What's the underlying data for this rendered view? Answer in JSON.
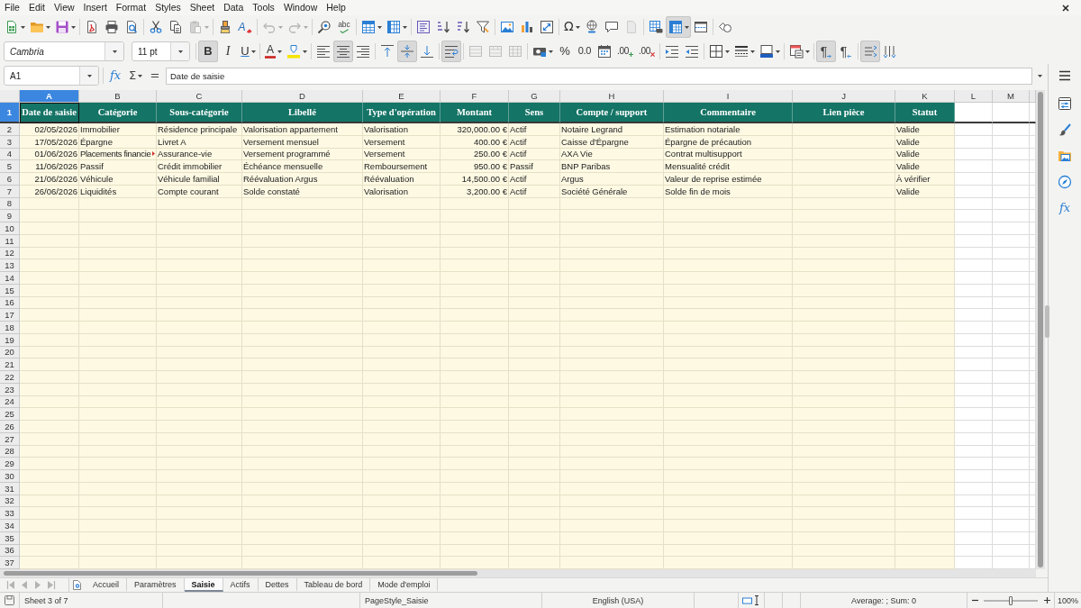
{
  "menu_bar": {
    "items": [
      "File",
      "Edit",
      "View",
      "Insert",
      "Format",
      "Styles",
      "Sheet",
      "Data",
      "Tools",
      "Window",
      "Help"
    ]
  },
  "standard_toolbar": {
    "groups": [
      [
        {
          "kind": "new",
          "dropdown": true,
          "active": false,
          "disabled": false
        },
        {
          "kind": "open",
          "dropdown": true,
          "active": false,
          "disabled": false
        },
        {
          "kind": "save",
          "dropdown": true,
          "active": false,
          "disabled": false
        }
      ],
      [
        {
          "kind": "pdf",
          "dropdown": false,
          "active": false,
          "disabled": false
        },
        {
          "kind": "print",
          "dropdown": false,
          "active": false,
          "disabled": false
        },
        {
          "kind": "preview",
          "dropdown": false,
          "active": false,
          "disabled": false
        }
      ],
      [
        {
          "kind": "cut",
          "dropdown": false,
          "active": false,
          "disabled": false
        },
        {
          "kind": "copy",
          "dropdown": false,
          "active": false,
          "disabled": false
        },
        {
          "kind": "paste",
          "dropdown": true,
          "active": false,
          "disabled": true
        }
      ],
      [
        {
          "kind": "clone",
          "dropdown": false,
          "active": false,
          "disabled": false
        },
        {
          "kind": "clear",
          "glyph": "A",
          "dropdown": false,
          "active": false,
          "disabled": false
        }
      ],
      [
        {
          "kind": "undo",
          "dropdown": true,
          "active": false,
          "disabled": true
        },
        {
          "kind": "redo",
          "dropdown": true,
          "active": false,
          "disabled": true
        }
      ],
      [
        {
          "kind": "find",
          "dropdown": false,
          "active": false,
          "disabled": false
        },
        {
          "kind": "spell",
          "glyph": "abc",
          "dropdown": false,
          "active": false,
          "disabled": false
        }
      ],
      [
        {
          "kind": "rows",
          "dropdown": true,
          "active": false,
          "disabled": false
        },
        {
          "kind": "columns",
          "dropdown": true,
          "active": false,
          "disabled": false
        }
      ],
      [
        {
          "kind": "sort",
          "dropdown": false,
          "active": false,
          "disabled": false
        },
        {
          "kind": "ascending",
          "dropdown": false,
          "active": false,
          "disabled": false
        },
        {
          "kind": "descending",
          "dropdown": false,
          "active": false,
          "disabled": false
        },
        {
          "kind": "filter",
          "dropdown": false,
          "active": false,
          "disabled": false
        }
      ],
      [
        {
          "kind": "image",
          "dropdown": false,
          "active": false,
          "disabled": false
        },
        {
          "kind": "chart",
          "dropdown": false,
          "active": false,
          "disabled": false
        },
        {
          "kind": "pivot",
          "dropdown": false,
          "active": false,
          "disabled": false
        }
      ],
      [
        {
          "kind": "special",
          "glyph": "Ω",
          "dropdown": true,
          "active": false,
          "disabled": false
        },
        {
          "kind": "link",
          "dropdown": false,
          "active": false,
          "disabled": false
        },
        {
          "kind": "comment",
          "dropdown": false,
          "active": false,
          "disabled": false
        },
        {
          "kind": "headers",
          "dropdown": false,
          "active": false,
          "disabled": true
        }
      ],
      [
        {
          "kind": "printarea",
          "dropdown": false,
          "active": false,
          "disabled": false
        },
        {
          "kind": "freeze",
          "dropdown": true,
          "active": true,
          "disabled": false
        },
        {
          "kind": "split",
          "dropdown": false,
          "active": false,
          "disabled": false
        }
      ],
      [
        {
          "kind": "shapes",
          "dropdown": false,
          "active": false,
          "disabled": false
        }
      ]
    ]
  },
  "formatting_toolbar": {
    "font_name": "Cambria",
    "font_size": "11 pt",
    "groups": [
      [
        {
          "kind": "bold",
          "glyph": "B",
          "dropdown": false,
          "active": true,
          "disabled": false
        },
        {
          "kind": "italic",
          "glyph": "I",
          "dropdown": false,
          "active": false,
          "disabled": false
        },
        {
          "kind": "underline",
          "glyph": "U",
          "dropdown": true,
          "active": false,
          "disabled": false
        }
      ],
      [
        {
          "kind": "fontcolor",
          "glyph": "A",
          "dropdown": true,
          "active": false,
          "disabled": false
        },
        {
          "kind": "highlight",
          "dropdown": true,
          "active": false,
          "disabled": false
        }
      ],
      [
        {
          "kind": "left",
          "dropdown": false,
          "active": false,
          "disabled": false
        },
        {
          "kind": "center",
          "dropdown": false,
          "active": true,
          "disabled": false
        },
        {
          "kind": "right",
          "dropdown": false,
          "active": false,
          "disabled": false
        }
      ],
      [
        {
          "kind": "top",
          "dropdown": false,
          "active": false,
          "disabled": false
        },
        {
          "kind": "middle",
          "dropdown": false,
          "active": true,
          "disabled": false
        },
        {
          "kind": "bottom",
          "dropdown": false,
          "active": false,
          "disabled": false
        }
      ],
      [
        {
          "kind": "wrap",
          "dropdown": false,
          "active": true,
          "disabled": false
        }
      ],
      [
        {
          "kind": "mergecenter",
          "dropdown": false,
          "active": false,
          "disabled": true
        },
        {
          "kind": "merge",
          "dropdown": false,
          "active": false,
          "disabled": true
        },
        {
          "kind": "unmerge",
          "dropdown": false,
          "active": false,
          "disabled": true
        }
      ],
      [
        {
          "kind": "currency",
          "dropdown": true,
          "active": false,
          "disabled": false
        },
        {
          "kind": "percent",
          "glyph": "%",
          "dropdown": false,
          "active": false,
          "disabled": false
        },
        {
          "kind": "number",
          "glyph": "0.0",
          "dropdown": false,
          "active": false,
          "disabled": false
        },
        {
          "kind": "date",
          "dropdown": false,
          "active": false,
          "disabled": false
        },
        {
          "kind": "adddecimal",
          "glyph": ".00",
          "dropdown": false,
          "active": false,
          "disabled": false
        },
        {
          "kind": "deletedecimal",
          "glyph": ".00",
          "dropdown": false,
          "active": false,
          "disabled": false
        }
      ],
      [
        {
          "kind": "indent",
          "dropdown": false,
          "active": false,
          "disabled": false
        },
        {
          "kind": "outdent",
          "dropdown": false,
          "active": false,
          "disabled": false
        }
      ],
      [
        {
          "kind": "borders",
          "dropdown": true,
          "active": false,
          "disabled": false
        },
        {
          "kind": "borderstyle",
          "dropdown": true,
          "active": false,
          "disabled": false
        },
        {
          "kind": "bordercolor",
          "dropdown": true,
          "active": false,
          "disabled": false
        }
      ],
      [
        {
          "kind": "conditional",
          "dropdown": true,
          "active": false,
          "disabled": false
        }
      ],
      [
        {
          "kind": "ltr",
          "glyph": "¶",
          "dropdown": false,
          "active": true,
          "disabled": false
        },
        {
          "kind": "rtl",
          "glyph": "¶",
          "dropdown": false,
          "active": false,
          "disabled": false
        }
      ],
      [
        {
          "kind": "horizontal",
          "dropdown": false,
          "active": true,
          "disabled": false
        },
        {
          "kind": "vertical",
          "dropdown": false,
          "active": false,
          "disabled": false
        }
      ]
    ]
  },
  "formula_bar": {
    "name_box": "A1",
    "function_wizard": "fx",
    "sum": "Σ",
    "formula": "=",
    "content": "Date de saisie"
  },
  "sheet": {
    "columns": [
      {
        "letter": "A",
        "kind": "date",
        "selected": true
      },
      {
        "letter": "B",
        "kind": "text",
        "selected": false
      },
      {
        "letter": "C",
        "kind": "text",
        "selected": false
      },
      {
        "letter": "D",
        "kind": "text",
        "selected": false
      },
      {
        "letter": "E",
        "kind": "text",
        "selected": false
      },
      {
        "letter": "F",
        "kind": "amount",
        "selected": false
      },
      {
        "letter": "G",
        "kind": "text",
        "selected": false
      },
      {
        "letter": "H",
        "kind": "text",
        "selected": false
      },
      {
        "letter": "I",
        "kind": "text",
        "selected": false
      },
      {
        "letter": "J",
        "kind": "text",
        "selected": false
      },
      {
        "letter": "K",
        "kind": "text",
        "selected": false
      },
      {
        "letter": "L",
        "kind": "blank",
        "selected": false
      },
      {
        "letter": "M",
        "kind": "blank",
        "selected": false
      }
    ],
    "rows": [
      {
        "number": "1",
        "kind": "header",
        "selected": true,
        "cells": [
          "Date de saisie",
          "Catégorie",
          "Sous-catégorie",
          "Libellé",
          "Type d'opération",
          "Montant",
          "Sens",
          "Compte / support",
          "Commentaire",
          "Lien pièce",
          "Statut"
        ]
      },
      {
        "number": "2",
        "kind": "data",
        "selected": false,
        "cells": [
          "02/05/2026",
          "Immobilier",
          "Résidence principale",
          "Valorisation appartement",
          "Valorisation",
          "320,000.00 €",
          "Actif",
          "Notaire Legrand",
          "Estimation notariale",
          null,
          "Valide"
        ]
      },
      {
        "number": "3",
        "kind": "data",
        "selected": false,
        "cells": [
          "17/05/2026",
          "Épargne",
          "Livret A",
          "Versement mensuel",
          "Versement",
          "400.00 €",
          "Actif",
          "Caisse d'Épargne",
          "Épargne de précaution",
          null,
          "Valide"
        ]
      },
      {
        "number": "4",
        "kind": "data",
        "selected": false,
        "cells": [
          "01/06/2026",
          {
            "text": "Placements financie",
            "clipped": true
          },
          "Assurance-vie",
          "Versement programmé",
          "Versement",
          "250.00 €",
          "Actif",
          "AXA Vie",
          "Contrat multisupport",
          null,
          "Valide"
        ]
      },
      {
        "number": "5",
        "kind": "data",
        "selected": false,
        "cells": [
          "11/06/2026",
          "Passif",
          "Crédit immobilier",
          "Échéance mensuelle",
          "Remboursement",
          "950.00 €",
          "Passif",
          "BNP Paribas",
          "Mensualité crédit",
          null,
          "Valide"
        ]
      },
      {
        "number": "6",
        "kind": "data",
        "selected": false,
        "cells": [
          "21/06/2026",
          "Véhicule",
          "Véhicule familial",
          "Réévaluation Argus",
          "Réévaluation",
          "14,500.00 €",
          "Actif",
          "Argus",
          "Valeur de reprise estimée",
          null,
          "À vérifier"
        ]
      },
      {
        "number": "7",
        "kind": "data",
        "selected": false,
        "cells": [
          "26/06/2026",
          "Liquidités",
          "Compte courant",
          "Solde constaté",
          "Valorisation",
          "3,200.00 €",
          "Actif",
          "Société Générale",
          "Solde fin de mois",
          null,
          "Valide"
        ]
      },
      {
        "number": "8",
        "kind": "data",
        "selected": false
      },
      {
        "number": "9",
        "kind": "data",
        "selected": false
      },
      {
        "number": "10",
        "kind": "data",
        "selected": false
      },
      {
        "number": "11",
        "kind": "data",
        "selected": false
      },
      {
        "number": "12",
        "kind": "data",
        "selected": false
      },
      {
        "number": "13",
        "kind": "data",
        "selected": false
      },
      {
        "number": "14",
        "kind": "data",
        "selected": false
      },
      {
        "number": "15",
        "kind": "data",
        "selected": false
      },
      {
        "number": "16",
        "kind": "data",
        "selected": false
      },
      {
        "number": "17",
        "kind": "data",
        "selected": false
      },
      {
        "number": "18",
        "kind": "data",
        "selected": false
      },
      {
        "number": "19",
        "kind": "data",
        "selected": false
      },
      {
        "number": "20",
        "kind": "data",
        "selected": false
      },
      {
        "number": "21",
        "kind": "data",
        "selected": false
      },
      {
        "number": "22",
        "kind": "data",
        "selected": false
      },
      {
        "number": "23",
        "kind": "data",
        "selected": false
      },
      {
        "number": "24",
        "kind": "data",
        "selected": false
      },
      {
        "number": "25",
        "kind": "data",
        "selected": false
      },
      {
        "number": "26",
        "kind": "data",
        "selected": false
      },
      {
        "number": "27",
        "kind": "data",
        "selected": false
      },
      {
        "number": "28",
        "kind": "data",
        "selected": false
      },
      {
        "number": "29",
        "kind": "data",
        "selected": false
      },
      {
        "number": "30",
        "kind": "data",
        "selected": false
      },
      {
        "number": "31",
        "kind": "data",
        "selected": false
      },
      {
        "number": "32",
        "kind": "data",
        "selected": false
      },
      {
        "number": "33",
        "kind": "data",
        "selected": false
      },
      {
        "number": "34",
        "kind": "data",
        "selected": false
      },
      {
        "number": "35",
        "kind": "data",
        "selected": false
      },
      {
        "number": "36",
        "kind": "data",
        "selected": false
      },
      {
        "number": "37",
        "kind": "data",
        "selected": false
      }
    ]
  },
  "sidebar": {
    "functions_label": "fx"
  },
  "sheet_tabs": {
    "navigation_disabled": true,
    "tabs": [
      {
        "label": "Accueil",
        "selected": false
      },
      {
        "label": "Paramètres",
        "selected": false
      },
      {
        "label": "Saisie",
        "selected": true
      },
      {
        "label": "Actifs",
        "selected": false
      },
      {
        "label": "Dettes",
        "selected": false
      },
      {
        "label": "Tableau de bord",
        "selected": false
      },
      {
        "label": "Mode d'emploi",
        "selected": false
      }
    ]
  },
  "status_bar": {
    "sheet_position": "Sheet 3 of 7",
    "page_style": "PageStyle_Saisie",
    "language": "English (USA)",
    "selection_summary": "Average: ; Sum: 0",
    "zoom": {
      "level": 0.5,
      "label": "100%"
    }
  }
}
